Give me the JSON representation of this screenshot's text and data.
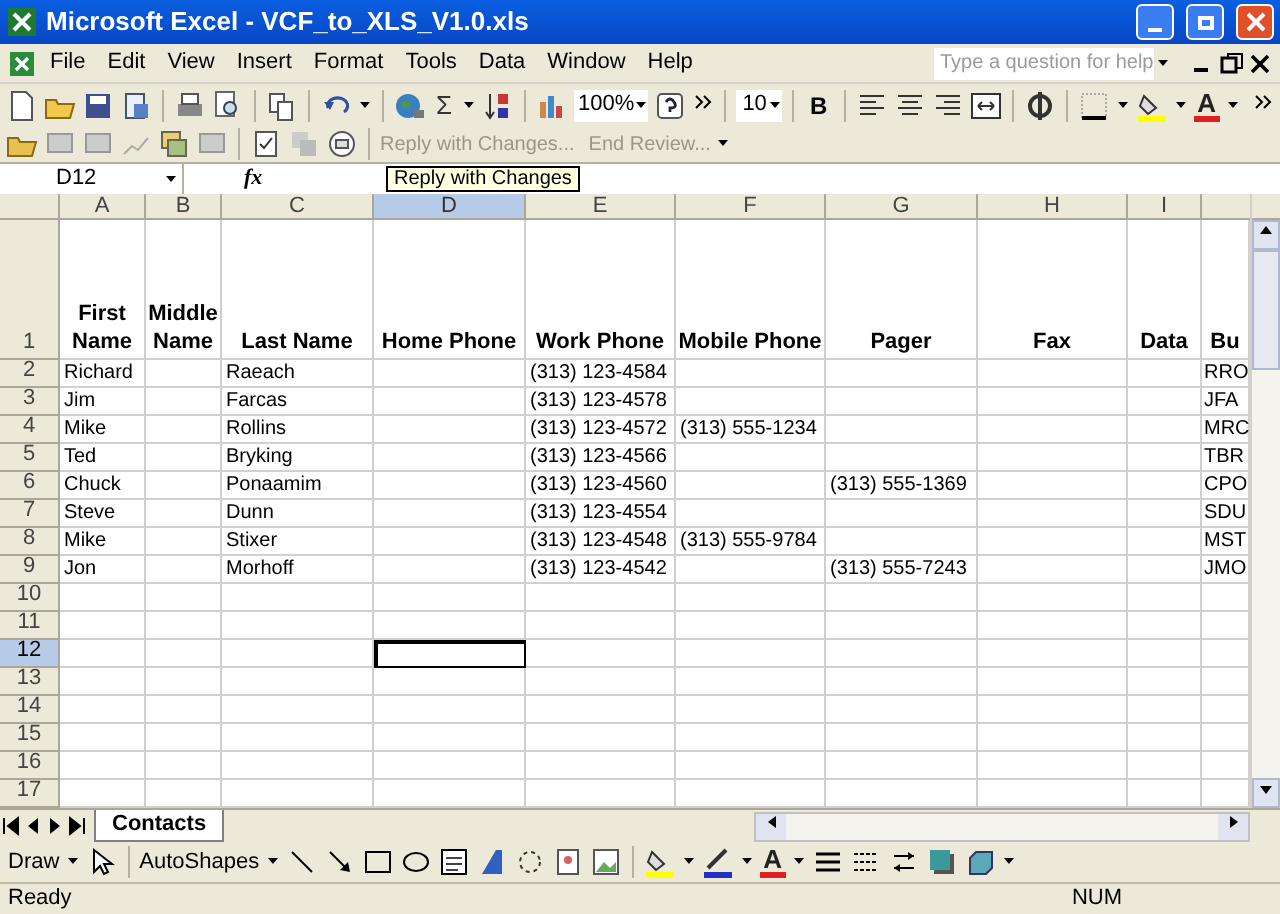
{
  "window": {
    "title": "Microsoft Excel - VCF_to_XLS_V1.0.xls"
  },
  "menu": [
    "File",
    "Edit",
    "View",
    "Insert",
    "Format",
    "Tools",
    "Data",
    "Window",
    "Help"
  ],
  "help_search": {
    "placeholder": "Type a question for help"
  },
  "standard_toolbar": {
    "autosum": "Σ",
    "zoom": "100%",
    "font_size": "10",
    "bold": "B",
    "font_color": "A"
  },
  "reviewing_toolbar": {
    "reply": "Reply with Changes...",
    "end_review": "End Review..."
  },
  "name_box": "D12",
  "formula_label": "fx",
  "tooltip": "Reply with Changes",
  "columns": [
    {
      "letter": "A",
      "selected": false
    },
    {
      "letter": "B",
      "selected": false
    },
    {
      "letter": "C",
      "selected": false
    },
    {
      "letter": "D",
      "selected": true
    },
    {
      "letter": "E",
      "selected": false
    },
    {
      "letter": "F",
      "selected": false
    },
    {
      "letter": "G",
      "selected": false
    },
    {
      "letter": "H",
      "selected": false
    },
    {
      "letter": "I",
      "selected": false
    }
  ],
  "rows": [
    {
      "number": "1",
      "selected": false
    },
    {
      "number": "2",
      "selected": false
    },
    {
      "number": "3",
      "selected": false
    },
    {
      "number": "4",
      "selected": false
    },
    {
      "number": "5",
      "selected": false
    },
    {
      "number": "6",
      "selected": false
    },
    {
      "number": "7",
      "selected": false
    },
    {
      "number": "8",
      "selected": false
    },
    {
      "number": "9",
      "selected": false
    },
    {
      "number": "10",
      "selected": false
    },
    {
      "number": "11",
      "selected": false
    },
    {
      "number": "12",
      "selected": true
    },
    {
      "number": "13",
      "selected": false
    },
    {
      "number": "14",
      "selected": false
    },
    {
      "number": "15",
      "selected": false
    },
    {
      "number": "16",
      "selected": false
    },
    {
      "number": "17",
      "selected": false
    }
  ],
  "header_row": {
    "first_name": "First Name",
    "middle_name": "Middle Name",
    "last_name": "Last Name",
    "home_phone": "Home Phone",
    "work_phone": "Work Phone",
    "mobile_phone": "Mobile Phone",
    "pager": "Pager",
    "fax": "Fax",
    "data": "Data",
    "column_10": "Bu"
  },
  "records": [
    {
      "first_name": "Richard",
      "last_name": "Raeach",
      "work_phone": "(313) 123-4584",
      "column_10": "RRO"
    },
    {
      "first_name": "Jim",
      "last_name": "Farcas",
      "work_phone": "(313) 123-4578",
      "column_10": "JFA"
    },
    {
      "first_name": "Mike",
      "last_name": "Rollins",
      "work_phone": "(313) 123-4572",
      "mobile_phone": "(313) 555-1234",
      "column_10": "MRC"
    },
    {
      "first_name": "Ted",
      "last_name": "Bryking",
      "work_phone": "(313) 123-4566",
      "column_10": "TBR"
    },
    {
      "first_name": "Chuck",
      "last_name": "Ponaamim",
      "work_phone": "(313) 123-4560",
      "pager": "(313) 555-1369",
      "column_10": "CPO"
    },
    {
      "first_name": "Steve",
      "last_name": "Dunn",
      "work_phone": "(313) 123-4554",
      "column_10": "SDU"
    },
    {
      "first_name": "Mike",
      "last_name": "Stixer",
      "work_phone": "(313) 123-4548",
      "mobile_phone": "(313) 555-9784",
      "column_10": "MST"
    },
    {
      "first_name": "Jon",
      "last_name": "Morhoff",
      "work_phone": "(313) 123-4542",
      "pager": "(313) 555-7243",
      "column_10": "JMO"
    }
  ],
  "sheet_tabs": [
    {
      "label": "Contacts",
      "selected": true
    }
  ],
  "drawing_toolbar": {
    "draw": "Draw",
    "autoshapes": "AutoShapes",
    "font_color": "A"
  },
  "status_bar": {
    "message": "Ready",
    "indicator": "NUM"
  }
}
